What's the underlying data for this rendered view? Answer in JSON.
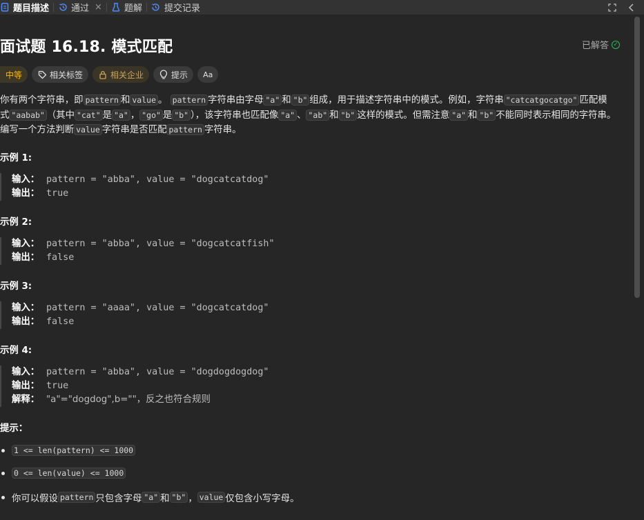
{
  "tabs": [
    {
      "label": "题目描述",
      "icon": "document-icon",
      "active": true
    },
    {
      "label": "通过",
      "icon": "history-icon",
      "active": false,
      "closable": true
    },
    {
      "label": "题解",
      "icon": "flask-icon",
      "active": false
    },
    {
      "label": "提交记录",
      "icon": "history-icon",
      "active": false
    }
  ],
  "tab_close_symbol": "×",
  "toolbar_right": {
    "expand_icon": "expand-icon",
    "collapse_icon": "chevron-left-icon"
  },
  "problem": {
    "title": "面试题 16.18. 模式匹配",
    "status": "已解答"
  },
  "tags": {
    "difficulty": "中等",
    "topics": "相关标签",
    "companies": "相关企业",
    "hint": "提示",
    "translate": "Aa"
  },
  "description": {
    "l1_a": "你有两个字符串，即",
    "code_pattern": "pattern",
    "and": "和",
    "code_value": "value",
    "l1_b": "。 ",
    "l1_c": "字符串由字母",
    "code_a": "\"a\"",
    "code_b": "\"b\"",
    "l1_d": "组成，用于描述字符串中的模式。例如，字符串",
    "code_catcat": "\"catcatgocatgo\"",
    "l1_e": "匹配模式",
    "code_aabab": "\"aabab\"",
    "l2_a": "（其中",
    "code_cat": "\"cat\"",
    "is": "是",
    "comma": "，",
    "code_go": "\"go\"",
    "l2_b": "），该字符串也匹配像",
    "dun": "、",
    "code_ab": "\"ab\"",
    "l2_c": "这样的模式。但需注意",
    "l2_d": "不能同时表示相同的字符串。编写一个方法判断",
    "l3_a": "字符串是否匹配",
    "l3_b": "字符串。"
  },
  "examples": [
    {
      "title": "示例 1:",
      "input": "pattern = \"abba\", value = \"dogcatcatdog\"",
      "output": "true"
    },
    {
      "title": "示例 2:",
      "input": "pattern = \"abba\", value = \"dogcatcatfish\"",
      "output": "false"
    },
    {
      "title": "示例 3:",
      "input": "pattern = \"aaaa\", value = \"dogcatcatdog\"",
      "output": "false"
    },
    {
      "title": "示例 4:",
      "input": "pattern = \"abba\", value = \"dogdogdogdog\"",
      "output": "true",
      "explanation": "\"a\"=\"dogdog\",b=\"\"，反之也符合规则"
    }
  ],
  "labels": {
    "input": "输入：",
    "output": "输出：",
    "explanation": "解释："
  },
  "hints": {
    "title": "提示：",
    "items": [
      "1 <= len(pattern) <= 1000",
      "0 <= len(value) <= 1000"
    ],
    "last_a": "你可以假设",
    "last_b": "只包含字母",
    "last_c": "仅包含小写字母。"
  },
  "colors": {
    "accent_difficulty": "#ffb800",
    "solved": "#2cbb5d",
    "background": "#262626"
  }
}
